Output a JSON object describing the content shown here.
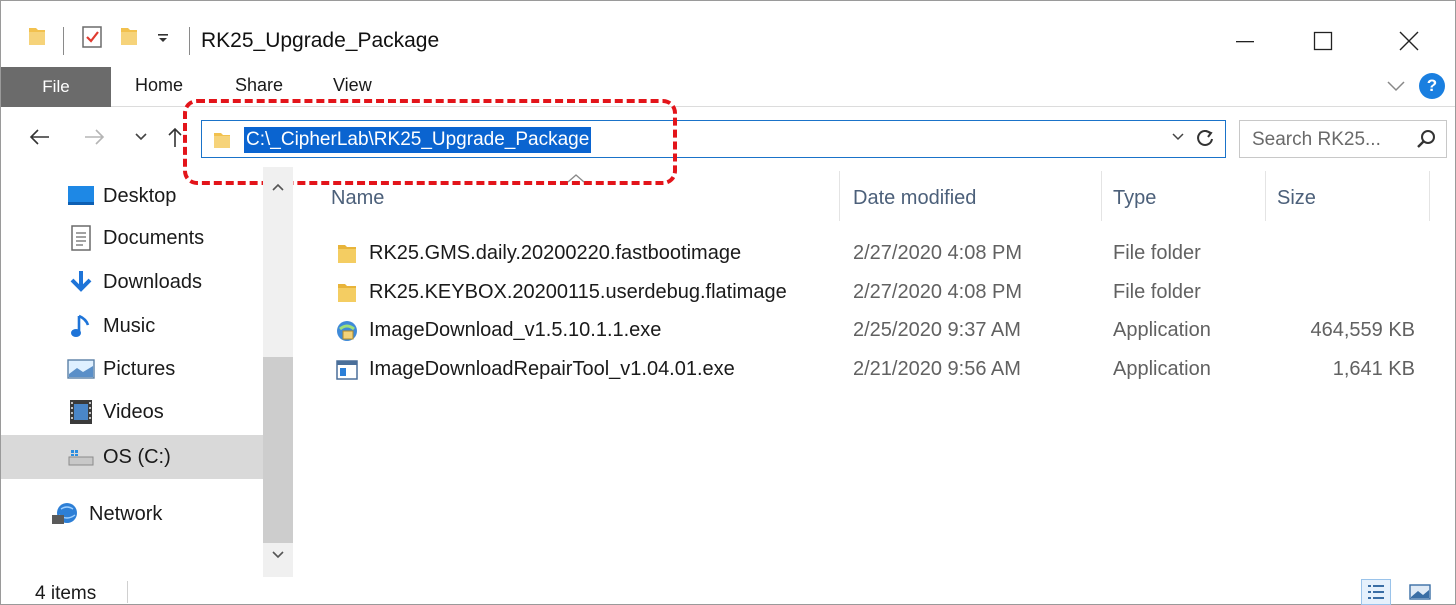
{
  "window": {
    "title": "RK25_Upgrade_Package",
    "quick_access_chevron": "⫪"
  },
  "ribbon": {
    "tabs": [
      {
        "label": "File"
      },
      {
        "label": "Home"
      },
      {
        "label": "Share"
      },
      {
        "label": "View"
      }
    ],
    "help": "?"
  },
  "navigation": {
    "address": "C:\\_CipherLab\\RK25_Upgrade_Package",
    "search_placeholder": "Search RK25..."
  },
  "sidebar": {
    "items": [
      {
        "label": "Desktop",
        "icon": "desktop-icon"
      },
      {
        "label": "Documents",
        "icon": "documents-icon"
      },
      {
        "label": "Downloads",
        "icon": "downloads-icon"
      },
      {
        "label": "Music",
        "icon": "music-icon"
      },
      {
        "label": "Pictures",
        "icon": "pictures-icon"
      },
      {
        "label": "Videos",
        "icon": "videos-icon"
      },
      {
        "label": "OS (C:)",
        "icon": "drive-icon",
        "selected": true
      },
      {
        "label": "Network",
        "icon": "network-icon"
      }
    ]
  },
  "file_list": {
    "columns": [
      "Name",
      "Date modified",
      "Type",
      "Size"
    ],
    "rows": [
      {
        "name": "RK25.GMS.daily.20200220.fastbootimage",
        "date": "2/27/2020 4:08 PM",
        "type": "File folder",
        "size": "",
        "icon": "folder-icon"
      },
      {
        "name": "RK25.KEYBOX.20200115.userdebug.flatimage",
        "date": "2/27/2020 4:08 PM",
        "type": "File folder",
        "size": "",
        "icon": "folder-icon"
      },
      {
        "name": "ImageDownload_v1.5.10.1.1.exe",
        "date": "2/25/2020 9:37 AM",
        "type": "Application",
        "size": "464,559 KB",
        "icon": "installer-app-icon"
      },
      {
        "name": "ImageDownloadRepairTool_v1.04.01.exe",
        "date": "2/21/2020 9:56 AM",
        "type": "Application",
        "size": "1,641 KB",
        "icon": "window-app-icon"
      }
    ]
  },
  "status": {
    "item_count": "4 items"
  },
  "colors": {
    "accent": "#0a64d0",
    "highlight_border": "#e3141a",
    "file_tab": "#6b6b6b",
    "folder": "#f2c14e"
  }
}
